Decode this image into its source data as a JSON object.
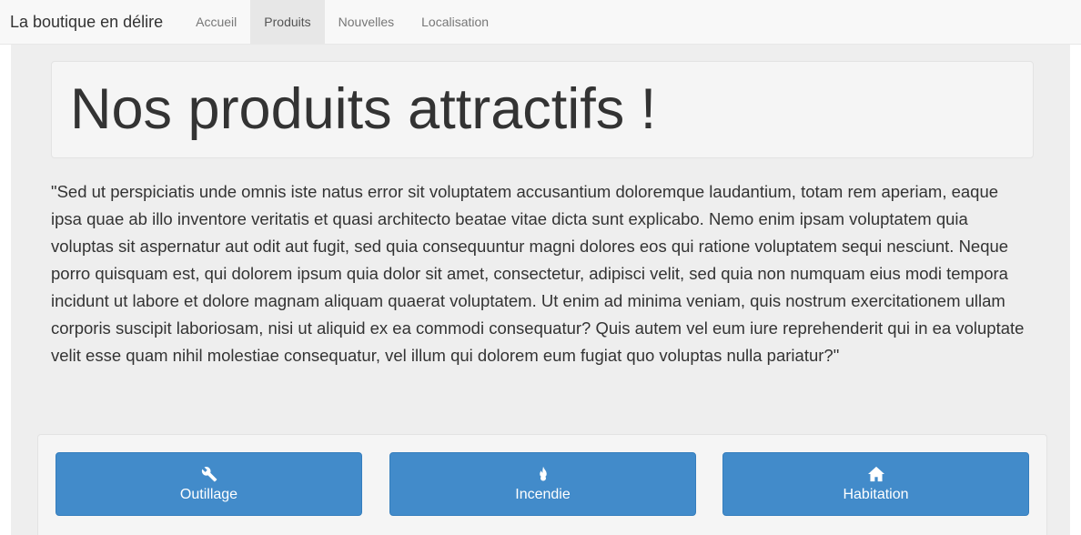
{
  "navbar": {
    "brand": "La boutique en délire",
    "items": [
      {
        "label": "Accueil",
        "active": false
      },
      {
        "label": "Produits",
        "active": true
      },
      {
        "label": "Nouvelles",
        "active": false
      },
      {
        "label": "Localisation",
        "active": false
      }
    ]
  },
  "main": {
    "heading": "Nos produits attractifs !",
    "description": "\"Sed ut perspiciatis unde omnis iste natus error sit voluptatem accusantium doloremque laudantium, totam rem aperiam, eaque ipsa quae ab illo inventore veritatis et quasi architecto beatae vitae dicta sunt explicabo. Nemo enim ipsam voluptatem quia voluptas sit aspernatur aut odit aut fugit, sed quia consequuntur magni dolores eos qui ratione voluptatem sequi nesciunt. Neque porro quisquam est, qui dolorem ipsum quia dolor sit amet, consectetur, adipisci velit, sed quia non numquam eius modi tempora incidunt ut labore et dolore magnam aliquam quaerat voluptatem. Ut enim ad minima veniam, quis nostrum exercitationem ullam corporis suscipit laboriosam, nisi ut aliquid ex ea commodi consequatur? Quis autem vel eum iure reprehenderit qui in ea voluptate velit esse quam nihil molestiae consequatur, vel illum qui dolorem eum fugiat quo voluptas nulla pariatur?\""
  },
  "categories": [
    {
      "label": "Outillage",
      "icon": "wrench-icon"
    },
    {
      "label": "Incendie",
      "icon": "fire-icon"
    },
    {
      "label": "Habitation",
      "icon": "home-icon"
    }
  ],
  "colors": {
    "primary": "#428bca",
    "navbar_bg": "#f8f8f8",
    "active_tab_bg": "#e7e7e7",
    "page_bg": "#eeeeee"
  }
}
